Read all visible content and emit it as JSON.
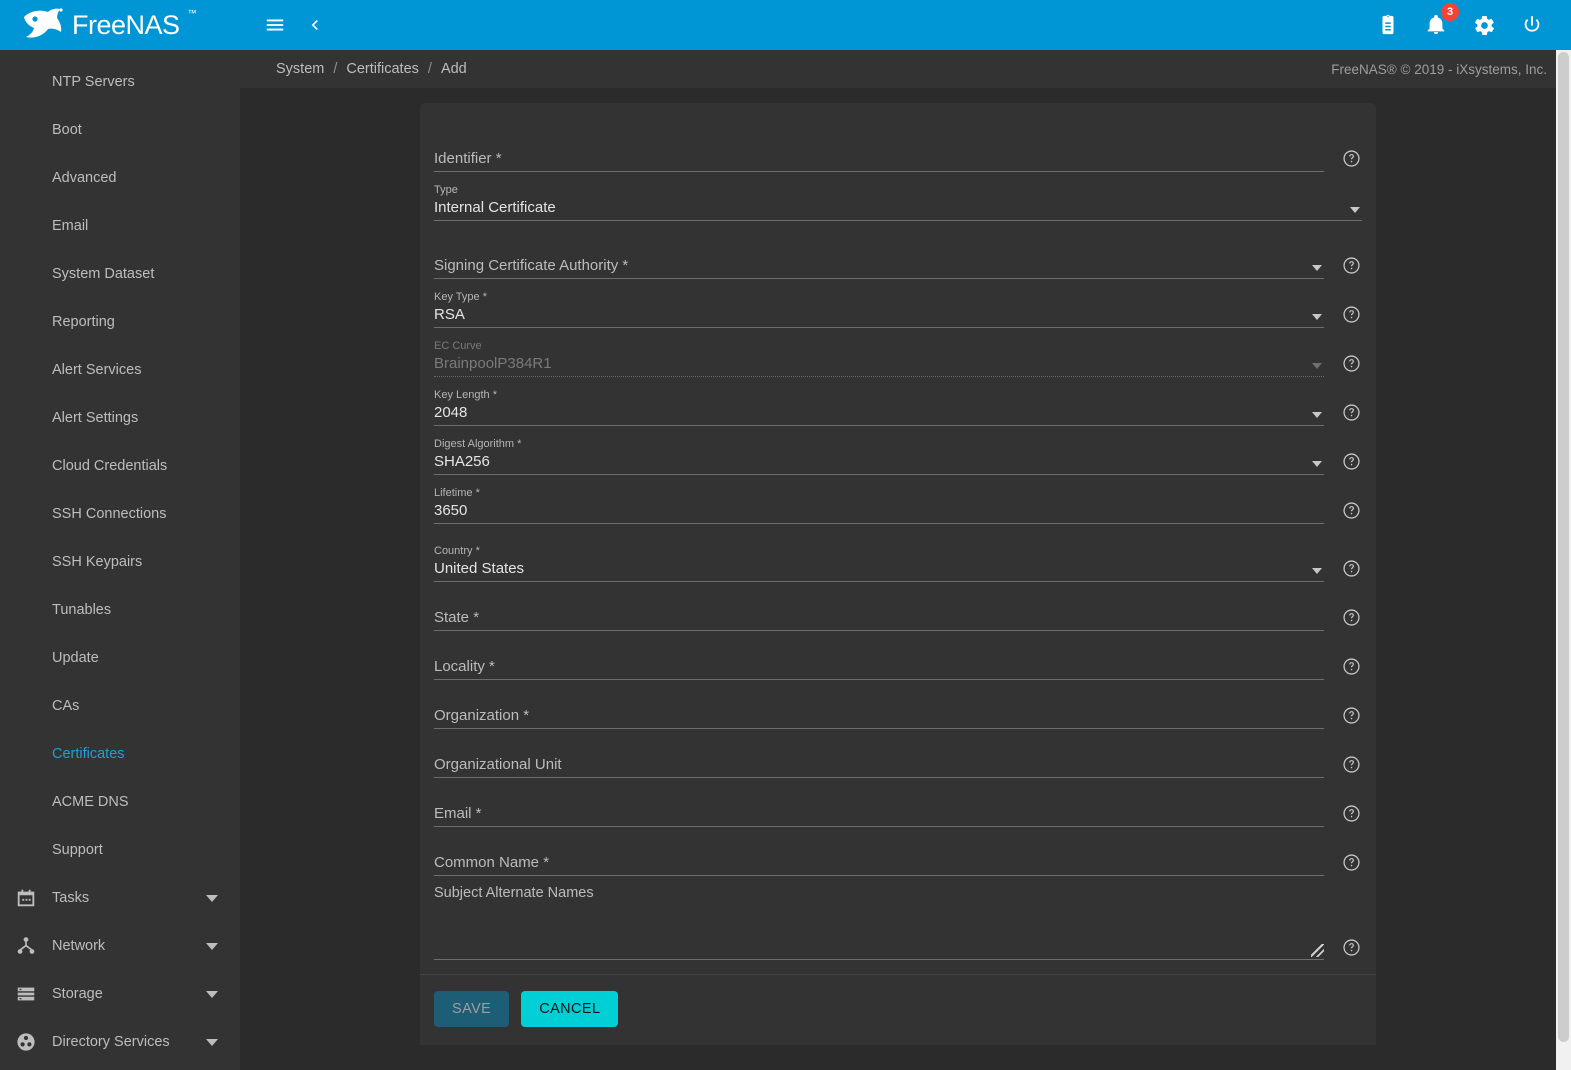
{
  "topbar": {
    "brand": "FreeNAS",
    "menu_icon": "hamburger-icon",
    "back_icon": "chevron-left-icon",
    "jobs_icon": "clipboard-icon",
    "alerts_icon": "bell-icon",
    "alerts_count": "3",
    "settings_icon": "gear-icon",
    "power_icon": "power-icon",
    "accent_color": "#0095d5",
    "badge_color": "#f44336"
  },
  "sidebar": {
    "items": [
      {
        "label": "NTP Servers",
        "active": false
      },
      {
        "label": "Boot",
        "active": false
      },
      {
        "label": "Advanced",
        "active": false
      },
      {
        "label": "Email",
        "active": false
      },
      {
        "label": "System Dataset",
        "active": false
      },
      {
        "label": "Reporting",
        "active": false
      },
      {
        "label": "Alert Services",
        "active": false
      },
      {
        "label": "Alert Settings",
        "active": false
      },
      {
        "label": "Cloud Credentials",
        "active": false
      },
      {
        "label": "SSH Connections",
        "active": false
      },
      {
        "label": "SSH Keypairs",
        "active": false
      },
      {
        "label": "Tunables",
        "active": false
      },
      {
        "label": "Update",
        "active": false
      },
      {
        "label": "CAs",
        "active": false
      },
      {
        "label": "Certificates",
        "active": true
      },
      {
        "label": "ACME DNS",
        "active": false
      },
      {
        "label": "Support",
        "active": false
      }
    ],
    "groups": [
      {
        "label": "Tasks",
        "icon": "calendar-icon"
      },
      {
        "label": "Network",
        "icon": "network-icon"
      },
      {
        "label": "Storage",
        "icon": "storage-icon"
      },
      {
        "label": "Directory Services",
        "icon": "directory-services-icon"
      }
    ],
    "active_color": "#1ca2d4"
  },
  "breadcrumb": {
    "items": [
      "System",
      "Certificates",
      "Add"
    ],
    "separator": "/",
    "copyright": "FreeNAS® © 2019 - iXsystems, Inc."
  },
  "form": {
    "fields": [
      {
        "label": "Identifier *",
        "value": "",
        "kind": "text",
        "filled": false,
        "help": true,
        "disabled": false
      },
      {
        "label": "Type",
        "value": "Internal Certificate",
        "kind": "select",
        "filled": true,
        "help": false,
        "disabled": false
      },
      {
        "label": "Signing Certificate Authority *",
        "value": "",
        "kind": "select",
        "filled": false,
        "help": true,
        "disabled": false
      },
      {
        "label": "Key Type *",
        "value": "RSA",
        "kind": "select",
        "filled": true,
        "help": true,
        "disabled": false
      },
      {
        "label": "EC Curve",
        "value": "BrainpoolP384R1",
        "kind": "select",
        "filled": true,
        "help": true,
        "disabled": true
      },
      {
        "label": "Key Length *",
        "value": "2048",
        "kind": "select",
        "filled": true,
        "help": true,
        "disabled": false
      },
      {
        "label": "Digest Algorithm *",
        "value": "SHA256",
        "kind": "select",
        "filled": true,
        "help": true,
        "disabled": false
      },
      {
        "label": "Lifetime *",
        "value": "3650",
        "kind": "text",
        "filled": true,
        "help": true,
        "disabled": false
      },
      {
        "label": "Country *",
        "value": "United States",
        "kind": "select",
        "filled": true,
        "help": true,
        "disabled": false
      },
      {
        "label": "State *",
        "value": "",
        "kind": "text",
        "filled": false,
        "help": true,
        "disabled": false
      },
      {
        "label": "Locality *",
        "value": "",
        "kind": "text",
        "filled": false,
        "help": true,
        "disabled": false
      },
      {
        "label": "Organization *",
        "value": "",
        "kind": "text",
        "filled": false,
        "help": true,
        "disabled": false
      },
      {
        "label": "Organizational Unit",
        "value": "",
        "kind": "text",
        "filled": false,
        "help": true,
        "disabled": false
      },
      {
        "label": "Email *",
        "value": "",
        "kind": "text",
        "filled": false,
        "help": true,
        "disabled": false
      },
      {
        "label": "Common Name *",
        "value": "",
        "kind": "text",
        "filled": false,
        "help": true,
        "disabled": false
      }
    ],
    "textarea": {
      "label": "Subject Alternate Names",
      "value": "",
      "help": true
    },
    "help_icon": "help-circle-icon",
    "dropdown_icon": "chevron-down-icon",
    "resize_icon": "resize-grip-icon"
  },
  "actions": {
    "save_label": "SAVE",
    "cancel_label": "CANCEL",
    "save_color": "#1d5d76",
    "cancel_color": "#00d0d6"
  }
}
